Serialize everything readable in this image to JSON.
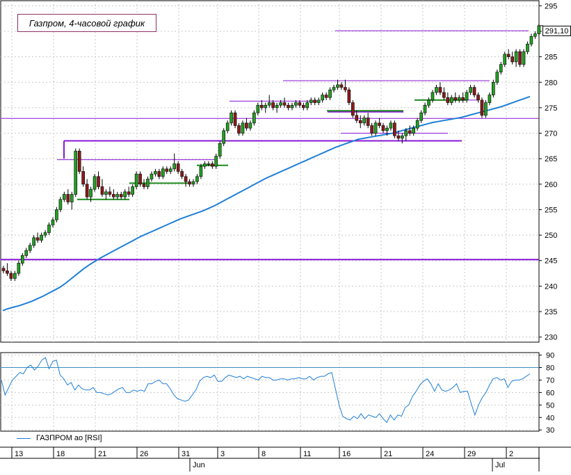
{
  "chart_data": [
    {
      "type": "candlestick",
      "title": "Газпром, 4-часовой график",
      "ylim": [
        229,
        296
      ],
      "y_ticks": [
        230,
        235,
        240,
        245,
        250,
        255,
        260,
        265,
        270,
        275,
        280,
        285,
        290,
        295
      ],
      "last_price": "291,10",
      "grid": true,
      "candles": [
        [
          243.5,
          244.0,
          242.5,
          243.0
        ],
        [
          243.0,
          244.5,
          242.0,
          242.5
        ],
        [
          242.5,
          243.0,
          241.0,
          241.5
        ],
        [
          241.5,
          243.0,
          241.0,
          242.5
        ],
        [
          242.5,
          245.0,
          242.0,
          244.5
        ],
        [
          244.5,
          246.5,
          244.0,
          246.0
        ],
        [
          246.0,
          247.5,
          245.5,
          247.0
        ],
        [
          247.0,
          248.5,
          246.5,
          248.0
        ],
        [
          248.0,
          250.0,
          247.5,
          249.5
        ],
        [
          249.5,
          250.5,
          248.5,
          249.0
        ],
        [
          249.0,
          250.5,
          248.5,
          250.0
        ],
        [
          250.0,
          251.0,
          249.5,
          250.5
        ],
        [
          250.5,
          252.5,
          250.0,
          252.0
        ],
        [
          252.0,
          253.5,
          251.5,
          253.0
        ],
        [
          253.0,
          255.5,
          252.5,
          255.0
        ],
        [
          255.0,
          257.5,
          254.5,
          257.0
        ],
        [
          257.0,
          258.5,
          256.5,
          258.0
        ],
        [
          258.0,
          259.0,
          256.0,
          256.5
        ],
        [
          256.5,
          258.5,
          255.0,
          258.0
        ],
        [
          258.0,
          267.0,
          257.5,
          266.5
        ],
        [
          266.5,
          267.0,
          262.0,
          262.5
        ],
        [
          262.5,
          263.5,
          259.5,
          260.0
        ],
        [
          260.0,
          261.0,
          257.0,
          257.5
        ],
        [
          257.5,
          259.5,
          256.5,
          259.0
        ],
        [
          259.0,
          262.0,
          258.5,
          261.5
        ],
        [
          261.5,
          262.5,
          259.0,
          259.5
        ],
        [
          259.5,
          261.0,
          257.5,
          258.0
        ],
        [
          258.0,
          259.0,
          257.0,
          258.5
        ],
        [
          258.5,
          259.5,
          257.5,
          258.0
        ],
        [
          258.0,
          259.0,
          257.0,
          257.5
        ],
        [
          257.5,
          258.5,
          257.0,
          258.0
        ],
        [
          258.0,
          258.5,
          257.0,
          257.5
        ],
        [
          257.5,
          259.0,
          257.0,
          258.5
        ],
        [
          258.5,
          259.5,
          257.5,
          258.0
        ],
        [
          258.0,
          260.0,
          257.5,
          259.5
        ],
        [
          259.5,
          262.5,
          259.0,
          262.0
        ],
        [
          262.0,
          262.5,
          259.5,
          260.0
        ],
        [
          260.0,
          261.0,
          259.0,
          259.5
        ],
        [
          259.5,
          261.5,
          259.0,
          261.0
        ],
        [
          261.0,
          262.5,
          260.5,
          262.0
        ],
        [
          262.0,
          263.0,
          261.5,
          262.5
        ],
        [
          262.5,
          263.0,
          261.0,
          261.5
        ],
        [
          261.5,
          263.5,
          261.0,
          263.0
        ],
        [
          263.0,
          263.5,
          262.0,
          262.5
        ],
        [
          262.5,
          263.5,
          262.0,
          263.0
        ],
        [
          263.0,
          266.0,
          262.5,
          264.0
        ],
        [
          264.0,
          264.5,
          262.0,
          262.5
        ],
        [
          262.5,
          263.0,
          261.0,
          261.5
        ],
        [
          261.5,
          262.0,
          259.5,
          260.5
        ],
        [
          260.5,
          261.0,
          259.5,
          260.0
        ],
        [
          260.0,
          261.0,
          259.5,
          260.5
        ],
        [
          260.5,
          262.0,
          260.0,
          261.5
        ],
        [
          261.5,
          264.0,
          261.0,
          263.5
        ],
        [
          263.5,
          264.5,
          263.0,
          264.0
        ],
        [
          264.0,
          264.5,
          263.5,
          264.0
        ],
        [
          264.0,
          264.5,
          263.0,
          263.5
        ],
        [
          263.5,
          266.0,
          263.0,
          265.5
        ],
        [
          265.5,
          268.5,
          265.0,
          268.0
        ],
        [
          268.0,
          271.0,
          267.5,
          270.5
        ],
        [
          270.5,
          272.5,
          270.0,
          272.0
        ],
        [
          272.0,
          274.5,
          271.5,
          274.0
        ],
        [
          274.0,
          274.5,
          271.0,
          271.5
        ],
        [
          271.5,
          272.0,
          269.5,
          270.0
        ],
        [
          270.0,
          272.5,
          269.5,
          272.0
        ],
        [
          272.0,
          273.0,
          270.5,
          271.0
        ],
        [
          271.0,
          272.5,
          270.5,
          272.0
        ],
        [
          272.0,
          274.5,
          271.5,
          274.0
        ],
        [
          274.0,
          276.0,
          273.5,
          275.5
        ],
        [
          275.5,
          276.5,
          274.5,
          275.0
        ],
        [
          275.0,
          276.0,
          274.0,
          275.5
        ],
        [
          275.5,
          277.5,
          275.0,
          276.0
        ],
        [
          276.0,
          276.5,
          274.5,
          275.0
        ],
        [
          275.0,
          276.0,
          274.0,
          275.5
        ],
        [
          275.5,
          276.5,
          275.0,
          276.0
        ],
        [
          276.0,
          277.0,
          275.0,
          275.5
        ],
        [
          275.5,
          276.0,
          274.5,
          275.0
        ],
        [
          275.0,
          276.0,
          274.5,
          275.5
        ],
        [
          275.5,
          276.5,
          275.0,
          276.0
        ],
        [
          276.0,
          276.5,
          275.0,
          275.5
        ],
        [
          275.5,
          276.0,
          274.5,
          275.0
        ],
        [
          275.0,
          276.5,
          274.5,
          276.0
        ],
        [
          276.0,
          277.0,
          275.5,
          276.5
        ],
        [
          276.5,
          277.0,
          275.5,
          276.0
        ],
        [
          276.0,
          277.0,
          275.5,
          276.5
        ],
        [
          276.5,
          278.0,
          276.0,
          277.5
        ],
        [
          277.5,
          278.0,
          276.5,
          277.0
        ],
        [
          277.0,
          279.0,
          276.5,
          278.5
        ],
        [
          278.5,
          279.5,
          278.0,
          279.0
        ],
        [
          279.0,
          280.5,
          278.5,
          279.5
        ],
        [
          279.5,
          280.0,
          278.5,
          279.0
        ],
        [
          279.0,
          280.5,
          278.0,
          278.5
        ],
        [
          278.5,
          279.0,
          275.5,
          276.0
        ],
        [
          276.0,
          276.5,
          273.0,
          273.5
        ],
        [
          273.5,
          274.5,
          272.0,
          272.5
        ],
        [
          272.5,
          273.5,
          271.0,
          272.0
        ],
        [
          272.0,
          273.5,
          271.5,
          273.0
        ],
        [
          273.0,
          274.0,
          271.0,
          271.5
        ],
        [
          271.5,
          272.0,
          269.5,
          270.0
        ],
        [
          270.0,
          272.5,
          269.5,
          272.0
        ],
        [
          272.0,
          273.0,
          271.0,
          271.5
        ],
        [
          271.5,
          272.0,
          270.0,
          270.5
        ],
        [
          270.5,
          271.5,
          269.5,
          271.0
        ],
        [
          271.0,
          272.5,
          270.5,
          272.0
        ],
        [
          272.0,
          272.5,
          269.0,
          269.5
        ],
        [
          269.5,
          270.5,
          268.5,
          269.0
        ],
        [
          269.0,
          270.0,
          268.0,
          269.5
        ],
        [
          269.5,
          271.0,
          268.5,
          270.5
        ],
        [
          270.5,
          271.5,
          269.5,
          270.0
        ],
        [
          270.0,
          271.5,
          269.5,
          271.0
        ],
        [
          271.0,
          273.0,
          270.5,
          272.5
        ],
        [
          272.5,
          274.5,
          272.0,
          274.0
        ],
        [
          274.0,
          276.0,
          273.5,
          275.5
        ],
        [
          275.5,
          277.0,
          275.0,
          276.5
        ],
        [
          276.5,
          278.5,
          276.0,
          278.0
        ],
        [
          278.0,
          279.5,
          277.5,
          279.0
        ],
        [
          279.0,
          280.0,
          277.5,
          278.0
        ],
        [
          278.0,
          279.0,
          276.5,
          277.0
        ],
        [
          277.0,
          278.0,
          275.5,
          276.0
        ],
        [
          276.0,
          277.5,
          275.5,
          277.0
        ],
        [
          277.0,
          278.0,
          276.0,
          276.5
        ],
        [
          276.5,
          277.5,
          276.0,
          277.0
        ],
        [
          277.0,
          278.0,
          276.0,
          276.5
        ],
        [
          276.5,
          278.5,
          276.0,
          278.0
        ],
        [
          278.0,
          279.5,
          277.5,
          279.0
        ],
        [
          279.0,
          279.5,
          277.0,
          277.5
        ],
        [
          277.5,
          278.0,
          276.0,
          276.5
        ],
        [
          276.5,
          277.0,
          273.0,
          273.5
        ],
        [
          273.5,
          276.5,
          273.0,
          276.0
        ],
        [
          276.0,
          278.0,
          275.5,
          277.5
        ],
        [
          277.5,
          280.5,
          277.0,
          280.0
        ],
        [
          280.0,
          282.5,
          279.5,
          282.0
        ],
        [
          282.0,
          284.0,
          281.5,
          283.5
        ],
        [
          283.5,
          286.0,
          283.0,
          285.5
        ],
        [
          285.5,
          286.5,
          284.5,
          285.0
        ],
        [
          285.0,
          286.0,
          283.5,
          284.0
        ],
        [
          284.0,
          286.5,
          283.0,
          286.0
        ],
        [
          286.0,
          286.5,
          283.0,
          283.5
        ],
        [
          283.5,
          286.5,
          283.0,
          286.0
        ],
        [
          286.0,
          288.0,
          285.5,
          287.5
        ],
        [
          287.5,
          289.5,
          287.0,
          289.0
        ],
        [
          289.0,
          290.0,
          288.5,
          289.5
        ],
        [
          289.5,
          291.5,
          289.0,
          291.1
        ]
      ],
      "moving_average": [
        235.2,
        235.6,
        235.9,
        236.2,
        236.6,
        237.0,
        237.5,
        238.0,
        238.6,
        239.2,
        239.8,
        240.6,
        241.5,
        242.4,
        243.3,
        244.1,
        244.8,
        245.5,
        246.1,
        246.7,
        247.3,
        247.9,
        248.5,
        249.1,
        249.7,
        250.2,
        250.7,
        251.2,
        251.7,
        252.2,
        252.7,
        253.2,
        253.6,
        254.0,
        254.4,
        254.8,
        255.3,
        255.8,
        256.4,
        257.0,
        257.6,
        258.2,
        258.8,
        259.4,
        260.0,
        260.6,
        261.2,
        261.7,
        262.2,
        262.7,
        263.2,
        263.7,
        264.2,
        264.7,
        265.2,
        265.7,
        266.2,
        266.7,
        267.2,
        267.6,
        268.0,
        268.4,
        268.8,
        269.0,
        269.2,
        269.4,
        269.6,
        269.8,
        270.0,
        270.3,
        270.6,
        270.9,
        271.2,
        271.5,
        271.8,
        272.1,
        272.3,
        272.5,
        272.7,
        272.9,
        273.1,
        273.4,
        273.7,
        274.0,
        274.3,
        274.6,
        274.9,
        275.2,
        275.6,
        276.0,
        276.4,
        276.8,
        277.2
      ],
      "levels": [
        {
          "value": 245.2,
          "color": "#8a17d6",
          "width": 2
        },
        {
          "value": 272.9,
          "color": "#8a17d6",
          "width": 1
        },
        {
          "value": 290.1,
          "color": "#8a17d6",
          "width": 1
        },
        {
          "value": 268.5,
          "color": "#8a17d6",
          "width": 2
        },
        {
          "value": 264.8,
          "color": "#8a17d6",
          "width": 1
        },
        {
          "value": 276.3,
          "color": "#8a17d6",
          "width": 1
        },
        {
          "value": 280.3,
          "color": "#8a17d6",
          "width": 1
        },
        {
          "value": 274.2,
          "color": "#8a17d6",
          "width": 2
        },
        {
          "value": 270.0,
          "color": "#8a17d6",
          "width": 1
        },
        {
          "value": 276.5,
          "color": "#8a17d6",
          "width": 1
        },
        {
          "value": 257.0,
          "color": "#1d8a1d",
          "width": 2
        },
        {
          "value": 260.2,
          "color": "#1d8a1d",
          "width": 2
        },
        {
          "value": 263.7,
          "color": "#1d8a1d",
          "width": 2
        },
        {
          "value": 274.4,
          "color": "#1d8a1d",
          "width": 2
        },
        {
          "value": 276.5,
          "color": "#1d8a1d",
          "width": 2
        }
      ],
      "grid_x_dates": [
        "13",
        "18",
        "21",
        "26",
        "31",
        "3",
        "8",
        "11",
        "16",
        "21",
        "24",
        "29",
        "2"
      ],
      "month_labels": [
        "Jun",
        "Jul"
      ]
    },
    {
      "type": "line",
      "series": [
        {
          "name": "ГАЗПРОМ ао [RSI]",
          "color": "#1e7fd6",
          "values": [
            70,
            58,
            64,
            70,
            73,
            76,
            75,
            80,
            82,
            78,
            81,
            86,
            88,
            79,
            85,
            86,
            74,
            71,
            66,
            68,
            62,
            66,
            63,
            62,
            62,
            64,
            60,
            60,
            59,
            58,
            59,
            61,
            63,
            64,
            60,
            60,
            62,
            61,
            62,
            61,
            67,
            67,
            69,
            70,
            67,
            67,
            63,
            58,
            55,
            54,
            53,
            54,
            58,
            62,
            69,
            72,
            73,
            72,
            74,
            69,
            69,
            72,
            74,
            73,
            72,
            73,
            71,
            73,
            72,
            71,
            70,
            73,
            72,
            72,
            70,
            70,
            71,
            71,
            70,
            71,
            71,
            72,
            71,
            71,
            73,
            70,
            72,
            73,
            73,
            75,
            76,
            63,
            50,
            41,
            39,
            38,
            41,
            39,
            43,
            39,
            42,
            41,
            40,
            43,
            39,
            36,
            42,
            38,
            42,
            41,
            48,
            50,
            57,
            61,
            66,
            69,
            71,
            67,
            61,
            67,
            62,
            61,
            62,
            64,
            67,
            60,
            61,
            61,
            51,
            42,
            50,
            56,
            60,
            66,
            71,
            72,
            70,
            71,
            64,
            69,
            70,
            70,
            71,
            73,
            75
          ]
        }
      ],
      "ylim": [
        29,
        92
      ],
      "y_ticks": [
        30,
        40,
        50,
        60,
        70,
        80,
        90
      ],
      "reference_line": 80
    }
  ]
}
